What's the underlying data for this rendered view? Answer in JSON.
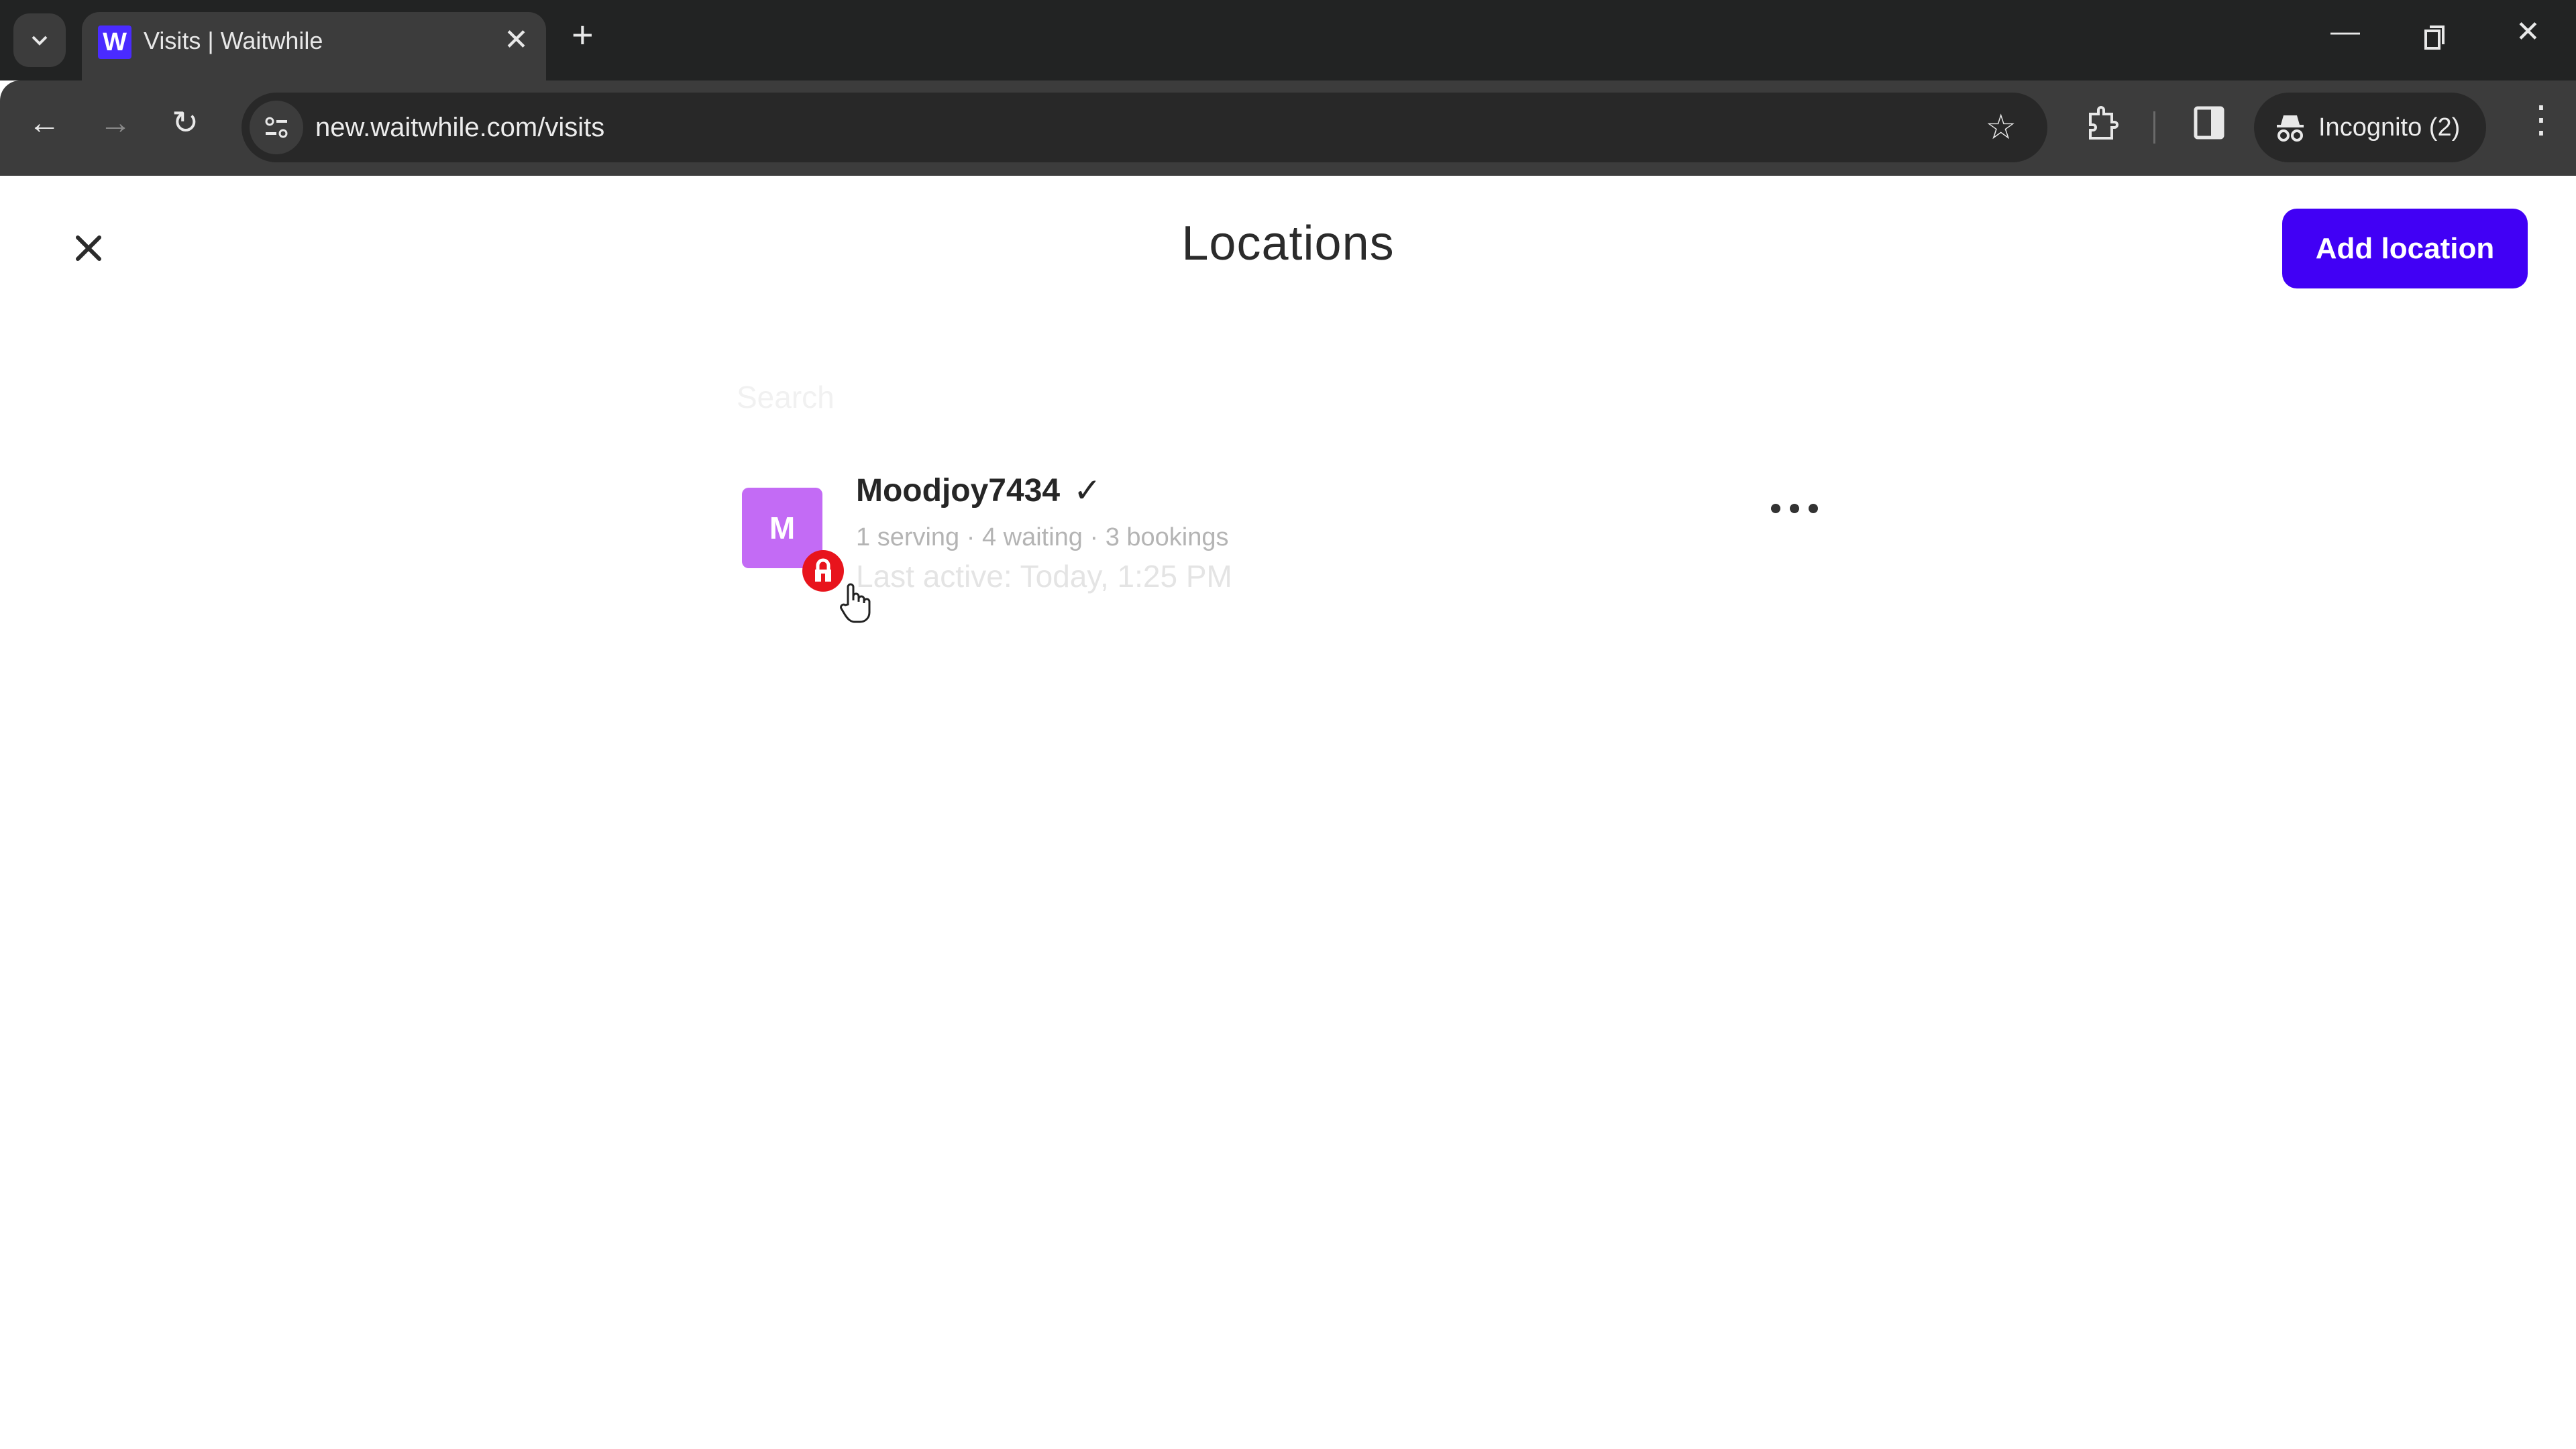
{
  "browser": {
    "tab_title": "Visits | Waitwhile",
    "favicon_letter": "W",
    "new_tab_label": "+",
    "url": "new.waitwhile.com/visits",
    "incognito_label": "Incognito (2)",
    "colors": {
      "favicon_bg": "#4a2bff",
      "chrome_dark": "#222323",
      "toolbar": "#3c3c3c"
    }
  },
  "page": {
    "title": "Locations",
    "add_location_label": "Add location",
    "search": {
      "placeholder": "Search",
      "value": ""
    },
    "colors": {
      "accent": "#4100f5",
      "avatar": "#c36bf5",
      "lock_badge": "#e8141c"
    }
  },
  "locations": [
    {
      "avatar_letter": "M",
      "name": "Moodjoy7434",
      "verified": true,
      "stats": "1 serving · 4 waiting · 3 bookings",
      "last_active": "Last active: Today, 1:25 PM",
      "locked": true
    }
  ]
}
